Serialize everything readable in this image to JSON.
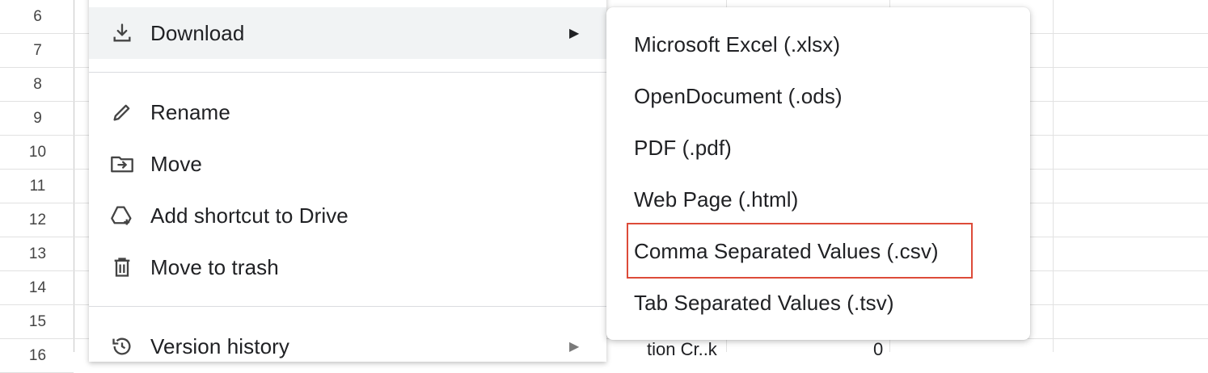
{
  "rows": [
    "6",
    "7",
    "8",
    "9",
    "10",
    "11",
    "12",
    "13",
    "14",
    "15",
    "16"
  ],
  "background_cells": {
    "partial_text": "tion Cr..k",
    "partial_number": "0"
  },
  "menu": {
    "items": [
      {
        "label": "Download",
        "icon": "download-icon",
        "submenu_arrow": "▶"
      },
      {
        "label": "Rename",
        "icon": "pencil-icon"
      },
      {
        "label": "Move",
        "icon": "folder-move-icon"
      },
      {
        "label": "Add shortcut to Drive",
        "icon": "drive-shortcut-icon"
      },
      {
        "label": "Move to trash",
        "icon": "trash-icon"
      },
      {
        "label": "Version history",
        "icon": "history-icon",
        "submenu_arrow": "▶"
      }
    ]
  },
  "download_submenu": {
    "items": [
      "Microsoft Excel (.xlsx)",
      "OpenDocument (.ods)",
      "PDF (.pdf)",
      "Web Page (.html)",
      "Comma Separated Values (.csv)",
      "Tab Separated Values (.tsv)"
    ],
    "highlighted_index": 4
  },
  "colors": {
    "hover": "#f1f3f4",
    "highlight_border": "#dd4b39",
    "text": "#202124"
  }
}
